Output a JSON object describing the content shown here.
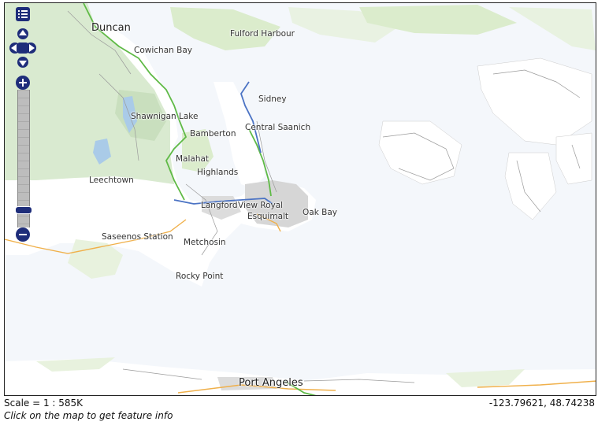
{
  "map": {
    "places": [
      {
        "name": "Duncan",
        "big": true
      },
      {
        "name": "Fulford Harbour"
      },
      {
        "name": "Cowichan Bay"
      },
      {
        "name": "Sidney"
      },
      {
        "name": "Shawnigan Lake"
      },
      {
        "name": "Central Saanich"
      },
      {
        "name": "Bamberton"
      },
      {
        "name": "Malahat"
      },
      {
        "name": "Highlands"
      },
      {
        "name": "Leechtown"
      },
      {
        "name": "Langford"
      },
      {
        "name": "View Royal"
      },
      {
        "name": "Esquimalt"
      },
      {
        "name": "Oak Bay"
      },
      {
        "name": "Saseenos Station"
      },
      {
        "name": "Metchosin"
      },
      {
        "name": "Rocky Point"
      },
      {
        "name": "Port Angeles",
        "big": true
      }
    ]
  },
  "controls": {
    "layer_switcher": "layer-list-icon",
    "pan": "pan-arrows-icon",
    "zoom_in": "plus-icon",
    "zoom_out": "minus-icon"
  },
  "footer": {
    "scale": "Scale = 1 : 585K",
    "coordinates": "-123.79621, 48.74238",
    "hint": "Click on the map to get feature info"
  },
  "colors": {
    "water": "#f4f7fb",
    "land": "#ffffff",
    "park": "#d9ead0",
    "highway_green": "#5fba46",
    "highway_blue": "#4b73c4",
    "control": "#1e2d7a"
  }
}
